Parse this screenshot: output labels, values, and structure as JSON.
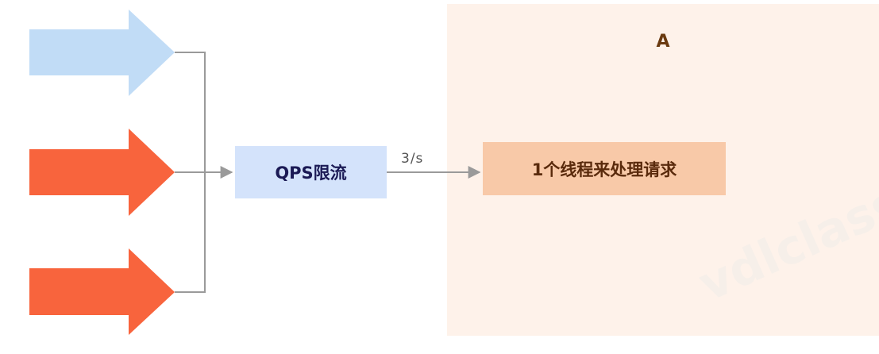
{
  "server": {
    "title": "A"
  },
  "limiter": {
    "label": "QPS限流"
  },
  "worker": {
    "label": "1个线程来处理请求"
  },
  "rate": {
    "label": "3/s"
  },
  "watermark": {
    "text": "vdlclass"
  },
  "arrows": [
    {
      "name": "request-arrow-1",
      "color": "#c1dcf6"
    },
    {
      "name": "request-arrow-2",
      "color": "#f8643d"
    },
    {
      "name": "request-arrow-3",
      "color": "#f8643d"
    }
  ],
  "colors": {
    "connector": "#9a9a9a",
    "panel": "#fef2ea",
    "limiter_box": "#d4e3fb",
    "worker_box": "#f8c9a8"
  }
}
